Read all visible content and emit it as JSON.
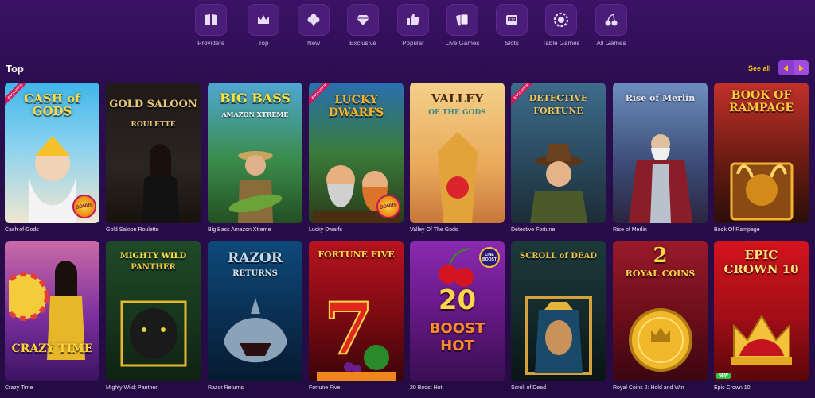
{
  "nav": {
    "items": [
      {
        "label": "Providers",
        "icon": "book-icon"
      },
      {
        "label": "Top",
        "icon": "crown-icon"
      },
      {
        "label": "New",
        "icon": "clover-icon"
      },
      {
        "label": "Exclusive",
        "icon": "diamond-icon"
      },
      {
        "label": "Popular",
        "icon": "thumbs-up-icon"
      },
      {
        "label": "Live Games",
        "icon": "cards-icon"
      },
      {
        "label": "Slots",
        "icon": "slot-machine-icon"
      },
      {
        "label": "Table Games",
        "icon": "chip-icon"
      },
      {
        "label": "All Games",
        "icon": "cherries-icon"
      }
    ]
  },
  "section": {
    "title": "Top",
    "see_all": "See all"
  },
  "games": [
    {
      "name": "Cash of Gods",
      "logo": "CASH of GODS",
      "badge": "EXCLUSIVE",
      "bonus": "BONUS"
    },
    {
      "name": "Gold Saloon Roulette",
      "logo": "GOLD SALOON",
      "sublogo": "ROULETTE"
    },
    {
      "name": "Big Bass Amazon Xtreme",
      "logo": "BIG BASS",
      "sublogo": "AMAZON XTREME"
    },
    {
      "name": "Lucky Dwarfs",
      "logo": "LUCKY DWARFS",
      "badge": "EXCLUSIVE",
      "bonus": "BONUS"
    },
    {
      "name": "Valley Of The Gods",
      "logo": "VALLEY",
      "sublogo": "OF THE GODS"
    },
    {
      "name": "Detective Fortune",
      "logo": "DETECTIVE FORTUNE",
      "badge": "EXCLUSIVE"
    },
    {
      "name": "Rise of Merlin",
      "logo": "Rise of Merlin"
    },
    {
      "name": "Book Of Rampage",
      "logo": "BOOK OF RAMPAGE"
    },
    {
      "name": "Crazy Time",
      "logo": "CRAZY TIME"
    },
    {
      "name": "Mighty Wild: Panther",
      "logo": "MIGHTY WILD",
      "sublogo": "PANTHER"
    },
    {
      "name": "Razor Returns",
      "logo": "RAZOR",
      "sublogo": "RETURNS"
    },
    {
      "name": "Fortune Five",
      "logo": "FORTUNE FIVE"
    },
    {
      "name": "20 Boost Hot",
      "logo": "20",
      "sublogo": "BOOST HOT",
      "tag": "LINE BOOST"
    },
    {
      "name": "Scroll of Dead",
      "logo": "SCROLL of DEAD"
    },
    {
      "name": "Royal Coins 2: Hold and Win",
      "logo": "2",
      "sublogo": "ROYAL COINS"
    },
    {
      "name": "Epic Crown 10",
      "logo": "EPIC",
      "sublogo": "CROWN 10",
      "new_badge": "NEW"
    }
  ],
  "colors": {
    "accent": "#f5c211",
    "arrow": "#a24be3",
    "background": "#2a0f4a"
  }
}
